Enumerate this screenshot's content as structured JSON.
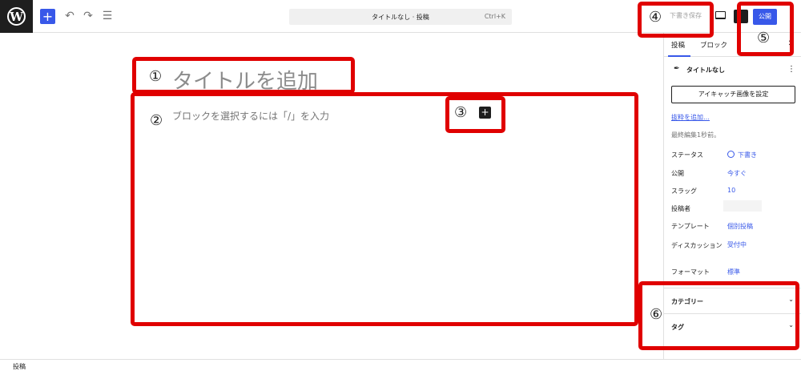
{
  "topbar": {
    "logo_letter": "W",
    "add_label": "+",
    "undo_icon": "↶",
    "redo_icon": "↷",
    "list_icon": "☰",
    "command_title": "タイトルなし · 投稿",
    "command_shortcut": "Ctrl+K",
    "save_draft_label": "下書き保存",
    "publish_label": "公開",
    "more_icon": "⋮"
  },
  "editor": {
    "title_placeholder": "タイトルを追加",
    "block_placeholder": "ブロックを選択するには「/」を入力",
    "inserter_label": "+"
  },
  "sidebar": {
    "tabs": [
      {
        "label": "投稿"
      },
      {
        "label": "ブロック"
      }
    ],
    "close_label": "✕",
    "post_icon": "✒",
    "post_name": "タイトルなし",
    "post_more": "⋮",
    "featured_image_button": "アイキャッチ画像を設定",
    "excerpt_link": "抜粋を追加…",
    "last_edited": "最終編集1秒前。",
    "meta": [
      {
        "label": "ステータス",
        "value": "下書き"
      },
      {
        "label": "公開",
        "value": "今すぐ"
      },
      {
        "label": "スラッグ",
        "value": "10"
      },
      {
        "label": "投稿者",
        "value": ""
      },
      {
        "label": "テンプレート",
        "value": "個別投稿"
      },
      {
        "label": "ディスカッション",
        "value": "受付中"
      },
      {
        "label": "フォーマット",
        "value": "標準"
      }
    ],
    "panels": [
      {
        "title": "カテゴリー",
        "chevron": "⌄"
      },
      {
        "title": "タグ",
        "chevron": "⌄"
      }
    ]
  },
  "footer": {
    "breadcrumb": "投稿"
  },
  "annotations": [
    {
      "number": "①"
    },
    {
      "number": "②"
    },
    {
      "number": "③"
    },
    {
      "number": "④"
    },
    {
      "number": "⑤"
    },
    {
      "number": "⑥"
    }
  ],
  "colors": {
    "accent": "#3858e9",
    "annotation": "#e00000",
    "dark": "#1e1e1e"
  }
}
